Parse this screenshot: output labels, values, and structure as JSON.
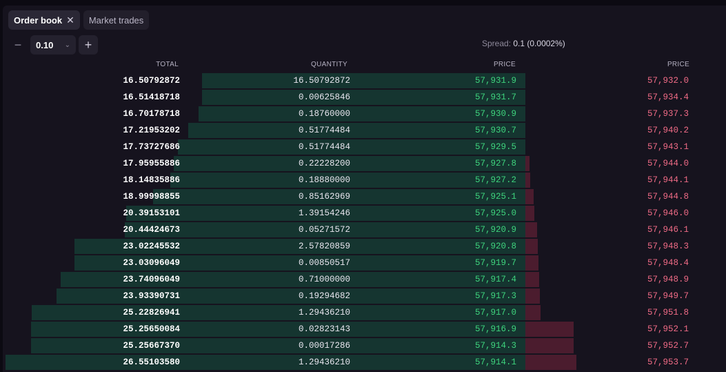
{
  "tabs": [
    {
      "label": "Order book",
      "active": true,
      "closable": true
    },
    {
      "label": "Market trades",
      "active": false,
      "closable": false
    }
  ],
  "controls": {
    "tick_size": "0.10",
    "minus_icon": "minus-icon",
    "plus_icon": "plus-icon",
    "chevron_icon": "chevron-down-icon"
  },
  "spread": {
    "label": "Spread:",
    "value": "0.1 (0.0002%)"
  },
  "headers": {
    "total": "TOTAL",
    "quantity": "QUANTITY",
    "bid_price": "PRICE",
    "ask_price": "PRICE"
  },
  "colors": {
    "bid_price": "#3ed47d",
    "ask_price": "#f06b86",
    "bid_bar": "#153530",
    "ask_bar": "#4b1c2e"
  },
  "scale": {
    "bid_total_max": 26.5510358,
    "ask_total_max": 26.5510358
  },
  "bids": [
    {
      "total": "16.50792872",
      "quantity": "16.50792872",
      "price": "57,931.9",
      "total_value": 16.50792872
    },
    {
      "total": "16.51418718",
      "quantity": "0.00625846",
      "price": "57,931.7",
      "total_value": 16.51418718
    },
    {
      "total": "16.70178718",
      "quantity": "0.18760000",
      "price": "57,930.9",
      "total_value": 16.70178718
    },
    {
      "total": "17.21953202",
      "quantity": "0.51774484",
      "price": "57,930.7",
      "total_value": 17.21953202
    },
    {
      "total": "17.73727686",
      "quantity": "0.51774484",
      "price": "57,929.5",
      "total_value": 17.73727686
    },
    {
      "total": "17.95955886",
      "quantity": "0.22228200",
      "price": "57,927.8",
      "total_value": 17.95955886
    },
    {
      "total": "18.14835886",
      "quantity": "0.18880000",
      "price": "57,927.2",
      "total_value": 18.14835886
    },
    {
      "total": "18.99998855",
      "quantity": "0.85162969",
      "price": "57,925.1",
      "total_value": 18.99998855
    },
    {
      "total": "20.39153101",
      "quantity": "1.39154246",
      "price": "57,925.0",
      "total_value": 20.39153101
    },
    {
      "total": "20.44424673",
      "quantity": "0.05271572",
      "price": "57,920.9",
      "total_value": 20.44424673
    },
    {
      "total": "23.02245532",
      "quantity": "2.57820859",
      "price": "57,920.8",
      "total_value": 23.02245532
    },
    {
      "total": "23.03096049",
      "quantity": "0.00850517",
      "price": "57,919.7",
      "total_value": 23.03096049
    },
    {
      "total": "23.74096049",
      "quantity": "0.71000000",
      "price": "57,917.4",
      "total_value": 23.74096049
    },
    {
      "total": "23.93390731",
      "quantity": "0.19294682",
      "price": "57,917.3",
      "total_value": 23.93390731
    },
    {
      "total": "25.22826941",
      "quantity": "1.29436210",
      "price": "57,917.0",
      "total_value": 25.22826941
    },
    {
      "total": "25.25650084",
      "quantity": "0.02823143",
      "price": "57,916.9",
      "total_value": 25.25650084
    },
    {
      "total": "25.25667370",
      "quantity": "0.00017286",
      "price": "57,914.3",
      "total_value": 25.2566737
    },
    {
      "total": "26.55103580",
      "quantity": "1.29436210",
      "price": "57,914.1",
      "total_value": 26.5510358
    }
  ],
  "asks": [
    {
      "price": "57,932.0",
      "depth": 0.0
    },
    {
      "price": "57,934.4",
      "depth": 0.0
    },
    {
      "price": "57,937.3",
      "depth": 0.0
    },
    {
      "price": "57,940.2",
      "depth": 0.0
    },
    {
      "price": "57,943.1",
      "depth": 0.0
    },
    {
      "price": "57,944.0",
      "depth": 0.0201
    },
    {
      "price": "57,944.1",
      "depth": 0.0235
    },
    {
      "price": "57,944.8",
      "depth": 0.0403
    },
    {
      "price": "57,946.0",
      "depth": 0.0436
    },
    {
      "price": "57,946.1",
      "depth": 0.057
    },
    {
      "price": "57,948.3",
      "depth": 0.0604
    },
    {
      "price": "57,948.4",
      "depth": 0.0638
    },
    {
      "price": "57,948.9",
      "depth": 0.0671
    },
    {
      "price": "57,949.7",
      "depth": 0.0705
    },
    {
      "price": "57,951.8",
      "depth": 0.0738
    },
    {
      "price": "57,952.1",
      "depth": 0.2349
    },
    {
      "price": "57,952.7",
      "depth": 0.2349
    },
    {
      "price": "57,953.7",
      "depth": 0.2483
    }
  ]
}
